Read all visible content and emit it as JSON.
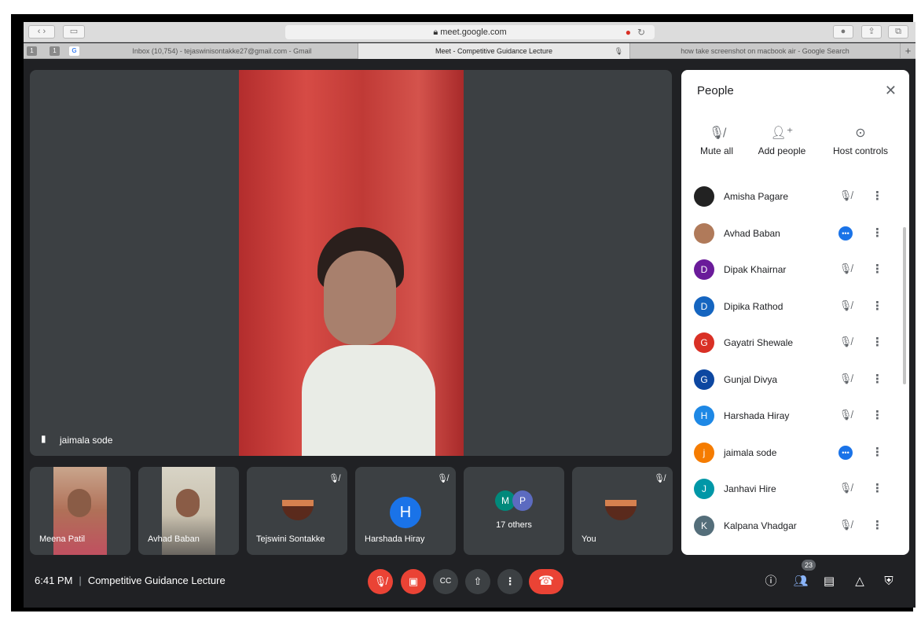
{
  "browser": {
    "url": "meet.google.com",
    "tabs": [
      {
        "label": "Inbox (10,754) - tejaswinisontakke27@gmail.com - Gmail"
      },
      {
        "label": "Meet - Competitive Guidance Lecture"
      },
      {
        "label": "how take screenshot on macbook air - Google Search"
      }
    ],
    "pinned": [
      "1",
      "1",
      "G"
    ]
  },
  "main": {
    "presenter_name": "jaimala sode"
  },
  "tiles": [
    {
      "name": "Meena Patil"
    },
    {
      "name": "Avhad Baban"
    },
    {
      "name": "Tejswini Sontakke"
    },
    {
      "name": "Harshada Hiray",
      "initial": "H"
    },
    {
      "name": "17 others",
      "initials": [
        "M",
        "P"
      ]
    },
    {
      "name": "You"
    }
  ],
  "bottom": {
    "time": "6:41 PM",
    "meeting_title": "Competitive Guidance Lecture",
    "participant_count": "23"
  },
  "panel": {
    "title": "People",
    "actions": {
      "mute_all": "Mute all",
      "add_people": "Add people",
      "host_controls": "Host controls"
    },
    "participants": [
      {
        "name": "Amisha Pagare",
        "initial": "",
        "color": "#222222",
        "state": "muted"
      },
      {
        "name": "Avhad Baban",
        "initial": "",
        "color": "#b07a5a",
        "state": "speaking"
      },
      {
        "name": "Dipak Khairnar",
        "initial": "D",
        "color": "#6a1b9a",
        "state": "muted"
      },
      {
        "name": "Dipika Rathod",
        "initial": "D",
        "color": "#1565c0",
        "state": "muted"
      },
      {
        "name": "Gayatri Shewale",
        "initial": "G",
        "color": "#d93025",
        "state": "muted"
      },
      {
        "name": "Gunjal Divya",
        "initial": "G",
        "color": "#0d47a1",
        "state": "muted"
      },
      {
        "name": "Harshada Hiray",
        "initial": "H",
        "color": "#1e88e5",
        "state": "muted"
      },
      {
        "name": "jaimala sode",
        "initial": "j",
        "color": "#f57c00",
        "state": "speaking"
      },
      {
        "name": "Janhavi Hire",
        "initial": "J",
        "color": "#0097a7",
        "state": "muted"
      },
      {
        "name": "Kalpana Vhadgar",
        "initial": "K",
        "color": "#546e7a",
        "state": "muted"
      }
    ]
  }
}
